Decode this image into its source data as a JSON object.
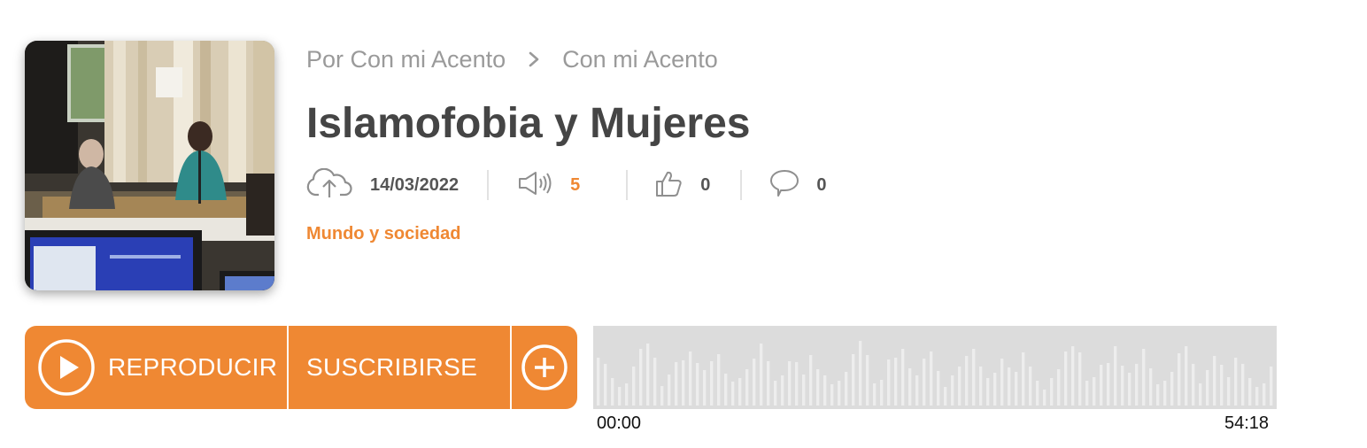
{
  "breadcrumb": {
    "author": "Por Con mi Acento",
    "program": "Con mi Acento"
  },
  "episode": {
    "title": "Islamofobia y Mujeres",
    "date": "14/03/2022",
    "plays": "5",
    "likes": "0",
    "comments": "0",
    "category": "Mundo y sociedad"
  },
  "player": {
    "play_label": "REPRODUCIR",
    "subscribe_label": "SUSCRIBIRSE",
    "time_start": "00:00",
    "time_end": "54:18"
  },
  "colors": {
    "accent": "#ef8833",
    "text": "#454545",
    "muted": "#9a9a9a",
    "wave_bg": "#dcdcdc"
  },
  "icons": [
    "cloud-upload-icon",
    "speaker-icon",
    "thumbs-up-icon",
    "comment-icon",
    "play-icon",
    "plus-icon",
    "chevron-right-icon"
  ]
}
